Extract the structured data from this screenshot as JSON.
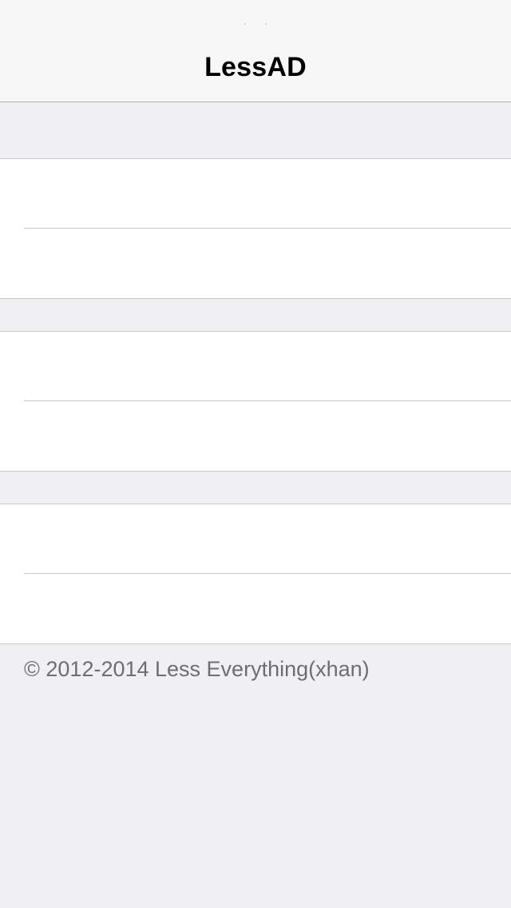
{
  "nav": {
    "title": "LessAD"
  },
  "sections": [
    {
      "rows": [
        {
          "label": ""
        },
        {
          "label": ""
        }
      ]
    },
    {
      "rows": [
        {
          "label": ""
        },
        {
          "label": ""
        }
      ]
    },
    {
      "rows": [
        {
          "label": ""
        },
        {
          "label": ""
        }
      ]
    }
  ],
  "footer": {
    "copyright": "© 2012-2014 Less Everything(xhan)"
  },
  "colors": {
    "background": "#efeff4",
    "nav_background": "#f7f7f7",
    "separator": "#c8c7cc",
    "footer_text": "#6d6d72"
  }
}
